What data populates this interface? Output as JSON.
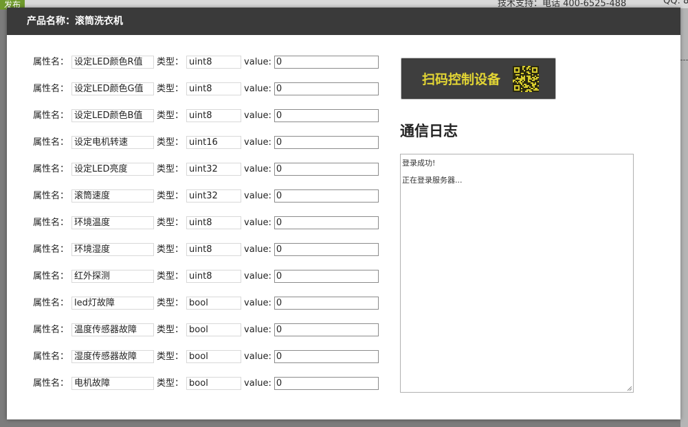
{
  "background": {
    "tag_label": "发布",
    "support_text": "技术支持：电话 400-6525-488",
    "qq_text": "QQ: 8"
  },
  "modal": {
    "title": "产品名称：滚筒洗衣机"
  },
  "labels": {
    "attr_name": "属性名：",
    "type": "类型：",
    "value": "value:"
  },
  "properties": [
    {
      "name": "设定LED颜色R值",
      "type": "uint8",
      "value": "0"
    },
    {
      "name": "设定LED颜色G值",
      "type": "uint8",
      "value": "0"
    },
    {
      "name": "设定LED颜色B值",
      "type": "uint8",
      "value": "0"
    },
    {
      "name": "设定电机转速",
      "type": "uint16",
      "value": "0"
    },
    {
      "name": "设定LED亮度",
      "type": "uint32",
      "value": "0"
    },
    {
      "name": "滚筒速度",
      "type": "uint32",
      "value": "0"
    },
    {
      "name": "环境温度",
      "type": "uint8",
      "value": "0"
    },
    {
      "name": "环境湿度",
      "type": "uint8",
      "value": "0"
    },
    {
      "name": "红外探测",
      "type": "uint8",
      "value": "0"
    },
    {
      "name": "led灯故障",
      "type": "bool",
      "value": "0"
    },
    {
      "name": "温度传感器故障",
      "type": "bool",
      "value": "0"
    },
    {
      "name": "湿度传感器故障",
      "type": "bool",
      "value": "0"
    },
    {
      "name": "电机故障",
      "type": "bool",
      "value": "0"
    }
  ],
  "scan_button": {
    "label": "扫码控制设备",
    "text_color": "#e2d534"
  },
  "log": {
    "title": "通信日志",
    "lines": [
      "登录成功!",
      "正在登录服务器..."
    ]
  },
  "colors": {
    "header_bg": "#3a3a3a",
    "button_bg": "#3e3e3e",
    "accent_yellow": "#e2d534"
  }
}
